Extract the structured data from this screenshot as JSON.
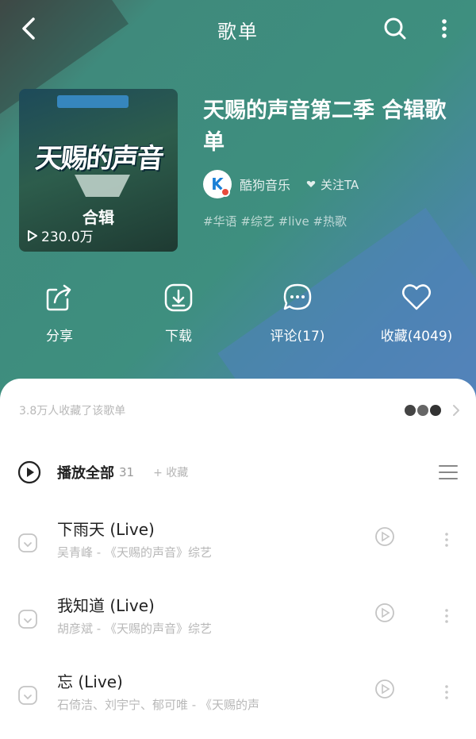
{
  "header": {
    "title": "歌单"
  },
  "cover": {
    "logo_text": "天赐的声音",
    "subtitle": "合辑",
    "plays": "230.0万"
  },
  "playlist": {
    "title": "天赐的声音第二季 合辑歌单",
    "creator_name": "酷狗音乐",
    "follow_label": "关注TA",
    "tags": "#华语 #综艺 #live #热歌"
  },
  "actions": [
    {
      "label": "分享"
    },
    {
      "label": "下载"
    },
    {
      "label": "评论(17)"
    },
    {
      "label": "收藏(4049)"
    }
  ],
  "promo": {
    "text": "3.8万人收藏了该歌单"
  },
  "play_all": {
    "label": "播放全部",
    "count": "31",
    "sub": "+ 收藏"
  },
  "songs": [
    {
      "title": "下雨天 (Live)",
      "meta": "吴青峰 - 《天赐的声音》综艺"
    },
    {
      "title": "我知道 (Live)",
      "meta": "胡彦斌 - 《天赐的声音》综艺"
    },
    {
      "title": "忘 (Live)",
      "meta": "石倚洁、刘宇宁、郁可唯 - 《天赐的声"
    }
  ],
  "colors": {
    "hero_green": "#3e8f7f",
    "hero_blue": "#5a86b8",
    "text_dark": "#222222",
    "text_muted": "#b8b8b8"
  }
}
